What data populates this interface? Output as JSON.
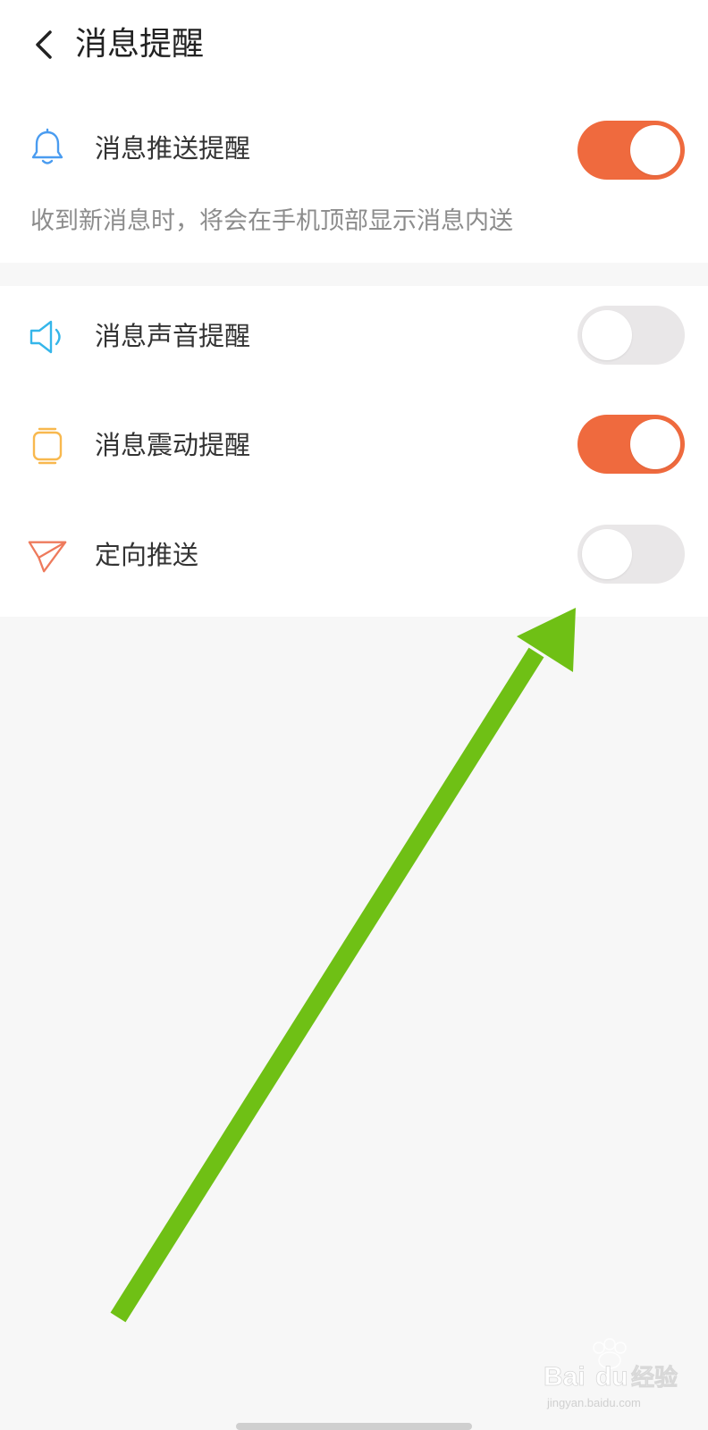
{
  "header": {
    "title": "消息提醒",
    "back_icon": "chevron-left-icon"
  },
  "settings": {
    "push": {
      "label": "消息推送提醒",
      "icon": "bell-icon",
      "icon_color": "#4a9cf0",
      "enabled": true,
      "description": "收到新消息时，将会在手机顶部显示消息内送"
    },
    "sound": {
      "label": "消息声音提醒",
      "icon": "speaker-icon",
      "icon_color": "#35b6ea",
      "enabled": false
    },
    "vibrate": {
      "label": "消息震动提醒",
      "icon": "vibrate-icon",
      "icon_color": "#f8b84e",
      "enabled": true
    },
    "targeted": {
      "label": "定向推送",
      "icon": "paper-plane-icon",
      "icon_color": "#ee7a5c",
      "enabled": false
    }
  },
  "colors": {
    "toggle_on": "#ef6a3e",
    "toggle_off": "#e9e7e8",
    "annotation_arrow": "#6fc015"
  },
  "watermark": {
    "brand": "Baidu经验",
    "url": "jingyan.baidu.com"
  }
}
